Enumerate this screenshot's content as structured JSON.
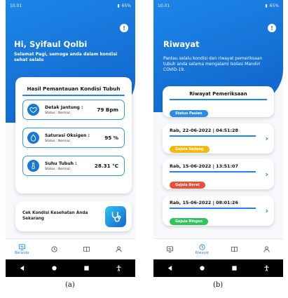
{
  "status_bar": {
    "time": "10.01",
    "battery": "65%"
  },
  "screen_a": {
    "greeting": "Hi, Syifaul Qolbi",
    "subtitle": "Selamat Pagi, semoga anda dalam kondisi sehat selalu",
    "monitor_title": "Hasil Pemantauan Kondisi Tubuh",
    "metrics": [
      {
        "label": "Detak Jantung :",
        "status": "Status : Normal",
        "value": "79 Bpm",
        "icon": "heart-icon"
      },
      {
        "label": "Saturasi Oksigen :",
        "status": "Status : Normal",
        "value": "95 %",
        "icon": "drop-icon"
      },
      {
        "label": "Suhu Tubuh :",
        "status": "Status : Normal",
        "value": "28.31 °C",
        "icon": "thermometer-icon"
      }
    ],
    "check_label": "Cek Kondisi Kesehatan Anda Sekarang",
    "nav": {
      "home_label": "Beranda"
    }
  },
  "screen_b": {
    "status_time": "10.01",
    "title": "Riwayat",
    "description": "Pantau selalu kondisi dan riwayat pemeriksaan tubuh anda selama mengalami Isolasi Mandiri COVID-19.",
    "section_title": "Riwayat Pemeriksaan",
    "status_pill": "Status Pasien",
    "entries": [
      {
        "date": "Rab, 22-06-2022 | 04:51:28",
        "status": "Gejala Sedang",
        "color": "#f3b814"
      },
      {
        "date": "Rab, 15-06-2022 | 13:51:07",
        "status": "Gejala Berat",
        "color": "#ef4e36"
      },
      {
        "date": "Rab, 15-06-2022 | 08:01:26",
        "status": "Gejala Ringan",
        "color": "#31c45a"
      }
    ],
    "nav": {
      "history_label": "Riwayat"
    }
  },
  "captions": {
    "a": "(a)",
    "b": "(b)"
  },
  "colors": {
    "primary": "#1d86e8",
    "nav_active": "#1d86e8"
  }
}
